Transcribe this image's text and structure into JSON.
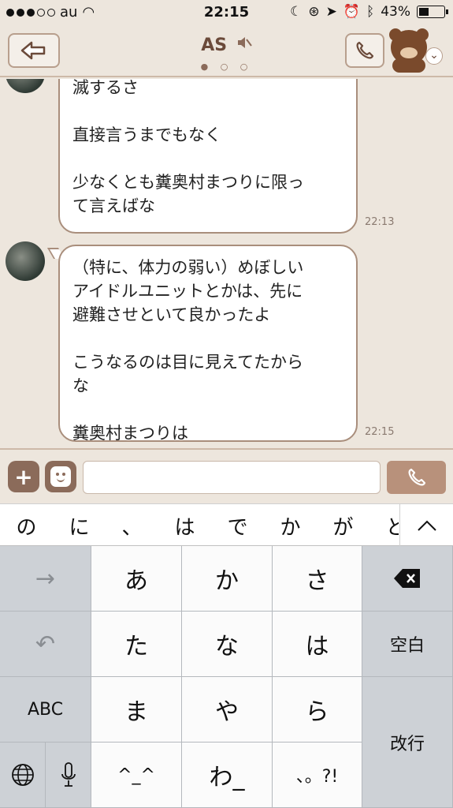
{
  "status_bar": {
    "carrier": "au",
    "time": "22:15",
    "battery": "43%",
    "battery_level": 0.43
  },
  "header": {
    "title": "AS",
    "page_indicator": "● ○ ○"
  },
  "messages": [
    {
      "text": "行くやつが居なくなれば自然消\n滅するさ\n\n直接言うまでもなく\n\n少なくとも糞奥村まつりに限っ\nて言えばな",
      "time": "22:13"
    },
    {
      "text": "（特に、体力の弱い）めぼしい\nアイドルユニットとかは、先に\n避難させといて良かったよ\n\nこうなるのは目に見えてたから\nな\n\n糞奥村まつりは",
      "time": "22:15"
    }
  ],
  "input": {
    "value": "",
    "placeholder": ""
  },
  "predictions": [
    "の",
    "に",
    "、",
    "は",
    "で",
    "か",
    "が",
    "と"
  ],
  "keyboard": {
    "arrow": "→",
    "undo": "↶",
    "abc": "ABC",
    "globe": "🌐",
    "mic": "🎤",
    "a": "あ",
    "ka": "か",
    "sa": "さ",
    "ta": "た",
    "na": "な",
    "ha": "は",
    "ma": "ま",
    "ya": "や",
    "ra": "ら",
    "kaomoji": "^_^",
    "wa": "わ_",
    "punct": "、。?!",
    "delete": "⌫",
    "space": "空白",
    "return": "改行"
  },
  "icons": {
    "back": "back-arrow-icon",
    "mute": "mute-icon",
    "call": "phone-icon",
    "add": "plus-icon",
    "emoji": "emoji-icon",
    "expand": "chevron-up-icon"
  },
  "colors": {
    "background": "#ede6dd",
    "accent": "#8b6b5a",
    "bubble_border": "#a98e7c"
  }
}
